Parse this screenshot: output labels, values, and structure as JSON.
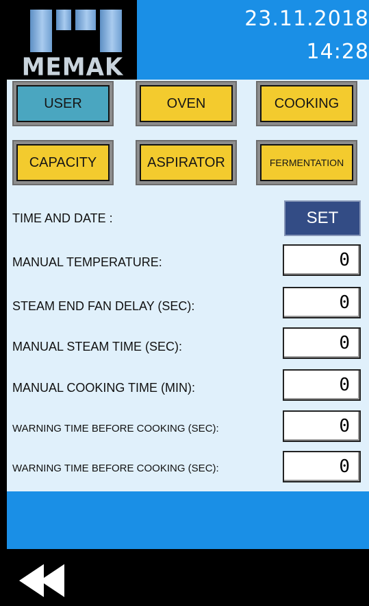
{
  "header": {
    "logo_text": "MEMAK",
    "date": "23.11.2018",
    "time": "14:28"
  },
  "menu": {
    "user": "USER",
    "oven": "OVEN",
    "cooking": "COOKING",
    "capacity": "CAPACITY",
    "aspirator": "ASPIRATOR",
    "fermentation": "FERMENTATION"
  },
  "settings": {
    "time_date_label": "TIME AND DATE :",
    "set_label": "SET",
    "rows": [
      {
        "label": "MANUAL TEMPERATURE:",
        "value": "0"
      },
      {
        "label": "STEAM END FAN DELAY (SEC):",
        "value": "0"
      },
      {
        "label": "MANUAL STEAM TIME (SEC):",
        "value": "0"
      },
      {
        "label": "MANUAL COOKING TIME (MIN):",
        "value": "0"
      },
      {
        "label": "WARNING TIME BEFORE COOKING (SEC):",
        "value": "0"
      },
      {
        "label": "WARNING TIME BEFORE COOKING (SEC):",
        "value": "0"
      }
    ]
  },
  "colors": {
    "header_blue": "#1a8fe6",
    "button_yellow": "#f3cb2e",
    "button_active_teal": "#4aa6c0",
    "set_button": "#334c85",
    "panel_background": "#e0f0fb"
  },
  "icons": {
    "back": "double-chevron-left-icon"
  }
}
